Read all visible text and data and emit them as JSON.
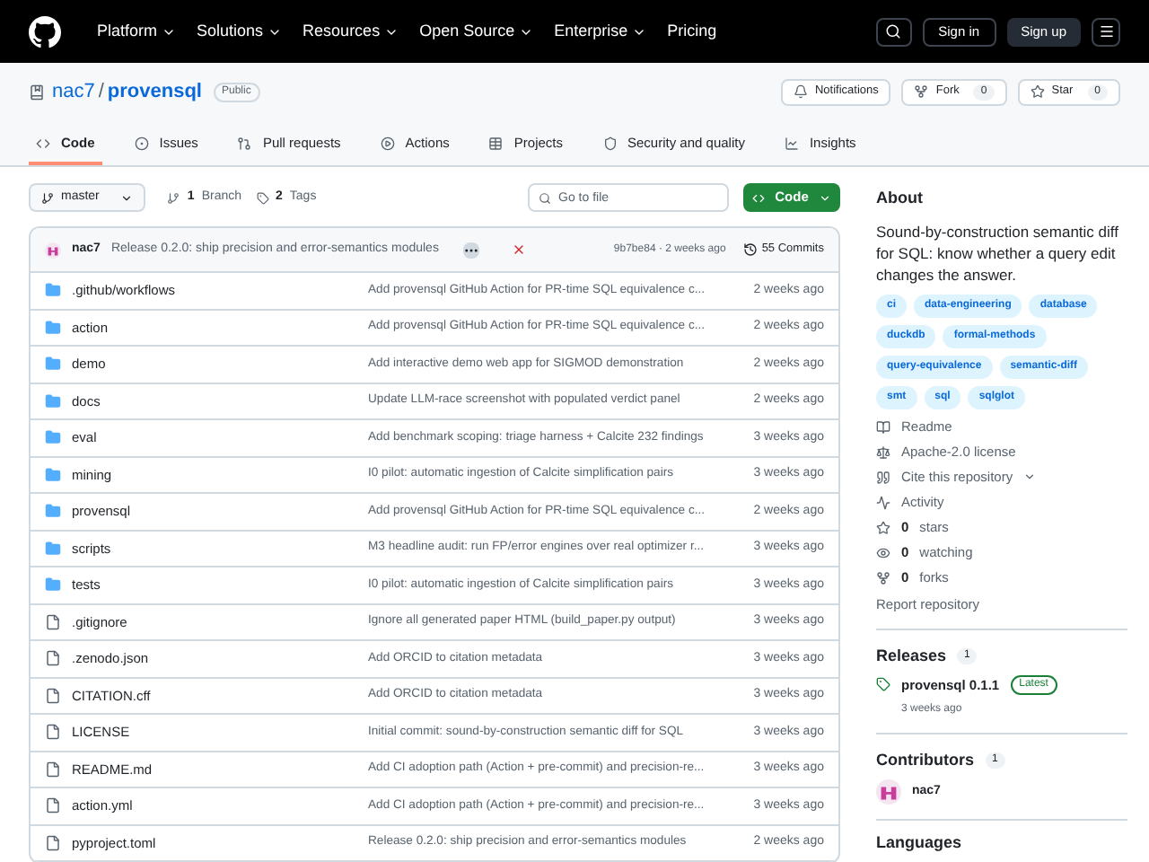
{
  "nav": {
    "items": [
      {
        "label": "Platform",
        "dropdown": true
      },
      {
        "label": "Solutions",
        "dropdown": true
      },
      {
        "label": "Resources",
        "dropdown": true
      },
      {
        "label": "Open Source",
        "dropdown": true
      },
      {
        "label": "Enterprise",
        "dropdown": true
      },
      {
        "label": "Pricing",
        "dropdown": false
      }
    ],
    "sign_in": "Sign in",
    "sign_up": "Sign up"
  },
  "repo": {
    "owner": "nac7",
    "separator": "/",
    "name": "provensql",
    "visibility": "Public",
    "actions": [
      {
        "kind": "notifications",
        "label": "Notifications"
      },
      {
        "kind": "fork",
        "label": "Fork",
        "count": "0"
      },
      {
        "kind": "star",
        "label": "Star",
        "count": "0"
      }
    ]
  },
  "tabs": [
    {
      "label": "Code",
      "selected": true
    },
    {
      "label": "Issues",
      "selected": false
    },
    {
      "label": "Pull requests",
      "selected": false
    },
    {
      "label": "Actions",
      "selected": false
    },
    {
      "label": "Projects",
      "selected": false
    },
    {
      "label": "Security and quality",
      "selected": false
    },
    {
      "label": "Insights",
      "selected": false
    }
  ],
  "toolbar": {
    "branch": "master",
    "branches_count": "1",
    "branches_label": "Branch",
    "tags_count": "2",
    "tags_label": "Tags",
    "search_placeholder": "Go to file",
    "code_button": "Code"
  },
  "latest_commit": {
    "author": "nac7",
    "message": "Release 0.2.0: ship precision and error-semantics modules",
    "checks_passed": false,
    "hash": "9b7be84",
    "time": "· 2 weeks ago",
    "commits": "55 Commits"
  },
  "files": [
    {
      "kind": "folder",
      "name": ".github/workflows",
      "message": "Add provensql GitHub Action for PR-time SQL equivalence c...",
      "time": "2 weeks ago"
    },
    {
      "kind": "folder",
      "name": "action",
      "message": "Add provensql GitHub Action for PR-time SQL equivalence c...",
      "time": "2 weeks ago"
    },
    {
      "kind": "folder",
      "name": "demo",
      "message": "Add interactive demo web app for SIGMOD demonstration",
      "time": "2 weeks ago"
    },
    {
      "kind": "folder",
      "name": "docs",
      "message": "Update LLM-race screenshot with populated verdict panel",
      "time": "2 weeks ago"
    },
    {
      "kind": "folder",
      "name": "eval",
      "message": "Add benchmark scoping: triage harness + Calcite 232 findings",
      "time": "3 weeks ago"
    },
    {
      "kind": "folder",
      "name": "mining",
      "message": "I0 pilot: automatic ingestion of Calcite simplification pairs",
      "time": "3 weeks ago"
    },
    {
      "kind": "folder",
      "name": "provensql",
      "message": "Add provensql GitHub Action for PR-time SQL equivalence c...",
      "time": "2 weeks ago"
    },
    {
      "kind": "folder",
      "name": "scripts",
      "message": "M3 headline audit: run FP/error engines over real optimizer r...",
      "time": "3 weeks ago"
    },
    {
      "kind": "folder",
      "name": "tests",
      "message": "I0 pilot: automatic ingestion of Calcite simplification pairs",
      "time": "3 weeks ago"
    },
    {
      "kind": "file",
      "name": ".gitignore",
      "message": "Ignore all generated paper HTML (build_paper.py output)",
      "time": "3 weeks ago"
    },
    {
      "kind": "file",
      "name": ".zenodo.json",
      "message": "Add ORCID to citation metadata",
      "time": "3 weeks ago"
    },
    {
      "kind": "file",
      "name": "CITATION.cff",
      "message": "Add ORCID to citation metadata",
      "time": "3 weeks ago"
    },
    {
      "kind": "file",
      "name": "LICENSE",
      "message": "Initial commit: sound-by-construction semantic diff for SQL",
      "time": "3 weeks ago"
    },
    {
      "kind": "file",
      "name": "README.md",
      "message": "Add CI adoption path (Action + pre-commit) and precision-re...",
      "time": "3 weeks ago"
    },
    {
      "kind": "file",
      "name": "action.yml",
      "message": "Add CI adoption path (Action + pre-commit) and precision-re...",
      "time": "3 weeks ago"
    },
    {
      "kind": "file",
      "name": "pyproject.toml",
      "message": "Release 0.2.0: ship precision and error-semantics modules",
      "time": "2 weeks ago"
    }
  ],
  "about": {
    "title": "About",
    "description": "Sound-by-construction semantic diff for SQL: know whether a query edit changes the answer.",
    "topics": [
      "ci",
      "data-engineering",
      "database",
      "duckdb",
      "formal-methods",
      "query-equivalence",
      "semantic-diff",
      "smt",
      "sql",
      "sqlglot"
    ],
    "links": [
      {
        "kind": "readme",
        "label": "Readme"
      },
      {
        "kind": "license",
        "label": "Apache-2.0 license"
      },
      {
        "kind": "cite",
        "label": "Cite this repository"
      },
      {
        "kind": "activity",
        "label": "Activity"
      },
      {
        "kind": "stars",
        "count": "0",
        "label": "stars"
      },
      {
        "kind": "watching",
        "count": "0",
        "label": "watching"
      },
      {
        "kind": "forks",
        "count": "0",
        "label": "forks"
      }
    ],
    "report": "Report repository"
  },
  "releases": {
    "title": "Releases",
    "count": "1",
    "name": "provensql 0.1.1",
    "badge": "Latest",
    "time": "3 weeks ago"
  },
  "contributors": {
    "title": "Contributors",
    "count": "1",
    "people": [
      {
        "name": "nac7"
      }
    ]
  },
  "languages": {
    "title": "Languages"
  }
}
